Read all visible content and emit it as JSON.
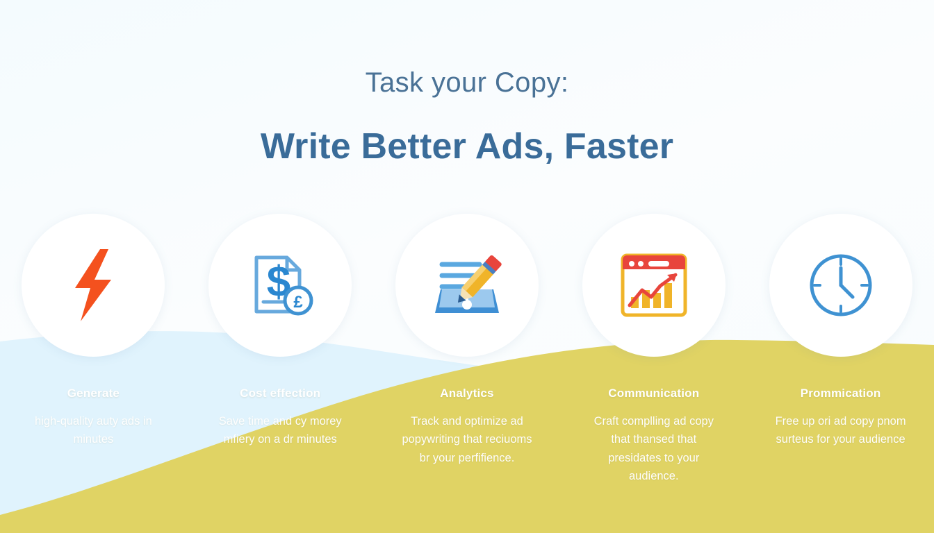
{
  "colors": {
    "background_top": "#f7fcfe",
    "wave_blue": "#e0f3fd",
    "wave_yellow": "#e0d364",
    "circle_fill": "#ffffff",
    "eyebrow_text": "#4a7296",
    "headline_text": "#3a6c99",
    "caption_text": "#ffffff",
    "icon_orange": "#f4511e",
    "icon_blue": "#3f92d2",
    "icon_light_blue": "#8ec3ea",
    "icon_yellow": "#f0b429",
    "icon_red": "#e8453c"
  },
  "headline": {
    "eyebrow": "Task your Copy:",
    "title": "Write Better Ads, Faster"
  },
  "features": [
    {
      "icon": "lightning-bolt-icon",
      "title": "Generate",
      "body": "high-quality auty ads in minutes"
    },
    {
      "icon": "document-dollar-icon",
      "title": "Cost effection",
      "body": "Save time and cy morey mfiery on a dr minutes"
    },
    {
      "icon": "notebook-pencil-icon",
      "title": "Analytics",
      "body": "Track and optimize ad popywriting that reciuoms br your perfifience."
    },
    {
      "icon": "browser-chart-icon",
      "title": "Communication",
      "body": "Craft complling ad copy that thansed that presidates to your audience."
    },
    {
      "icon": "clock-icon",
      "title": "Prommication",
      "body": "Free up ori ad copy pnom surteus for your audience"
    }
  ]
}
